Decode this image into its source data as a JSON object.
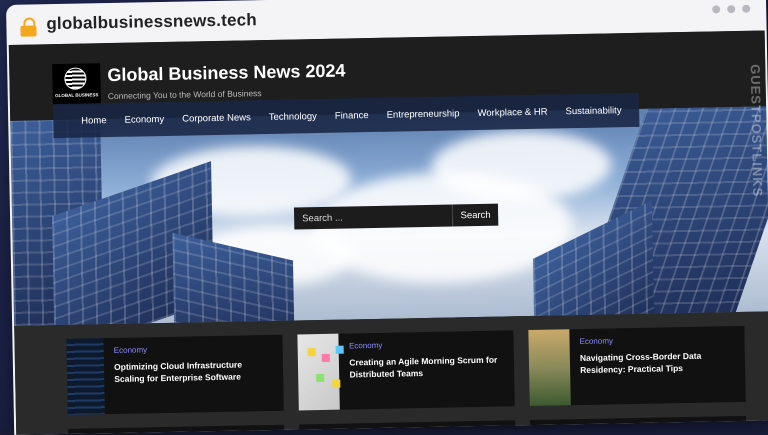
{
  "browser": {
    "url": "globalbusinessnews.tech"
  },
  "site": {
    "logo_text": "GLOBAL BUSINESS",
    "title": "Global Business News 2024",
    "tagline": "Connecting You to the World of Business"
  },
  "nav": {
    "items": [
      "Home",
      "Economy",
      "Corporate News",
      "Technology",
      "Finance",
      "Entrepreneurship",
      "Workplace & HR",
      "Sustainability"
    ]
  },
  "search": {
    "placeholder": "Search ...",
    "button_label": "Search"
  },
  "cards": [
    {
      "category": "Economy",
      "title": "Optimizing Cloud Infrastructure Scaling for Enterprise Software"
    },
    {
      "category": "Economy",
      "title": "Creating an Agile Morning Scrum for Distributed Teams"
    },
    {
      "category": "Economy",
      "title": "Navigating Cross-Border Data Residency: Practical Tips"
    }
  ],
  "watermark": {
    "text": "GUESTPOSTLINKS"
  },
  "colors": {
    "accent": "#8b8cff",
    "lock": "#f2a91e",
    "header_bg": "#1e1e1e"
  }
}
